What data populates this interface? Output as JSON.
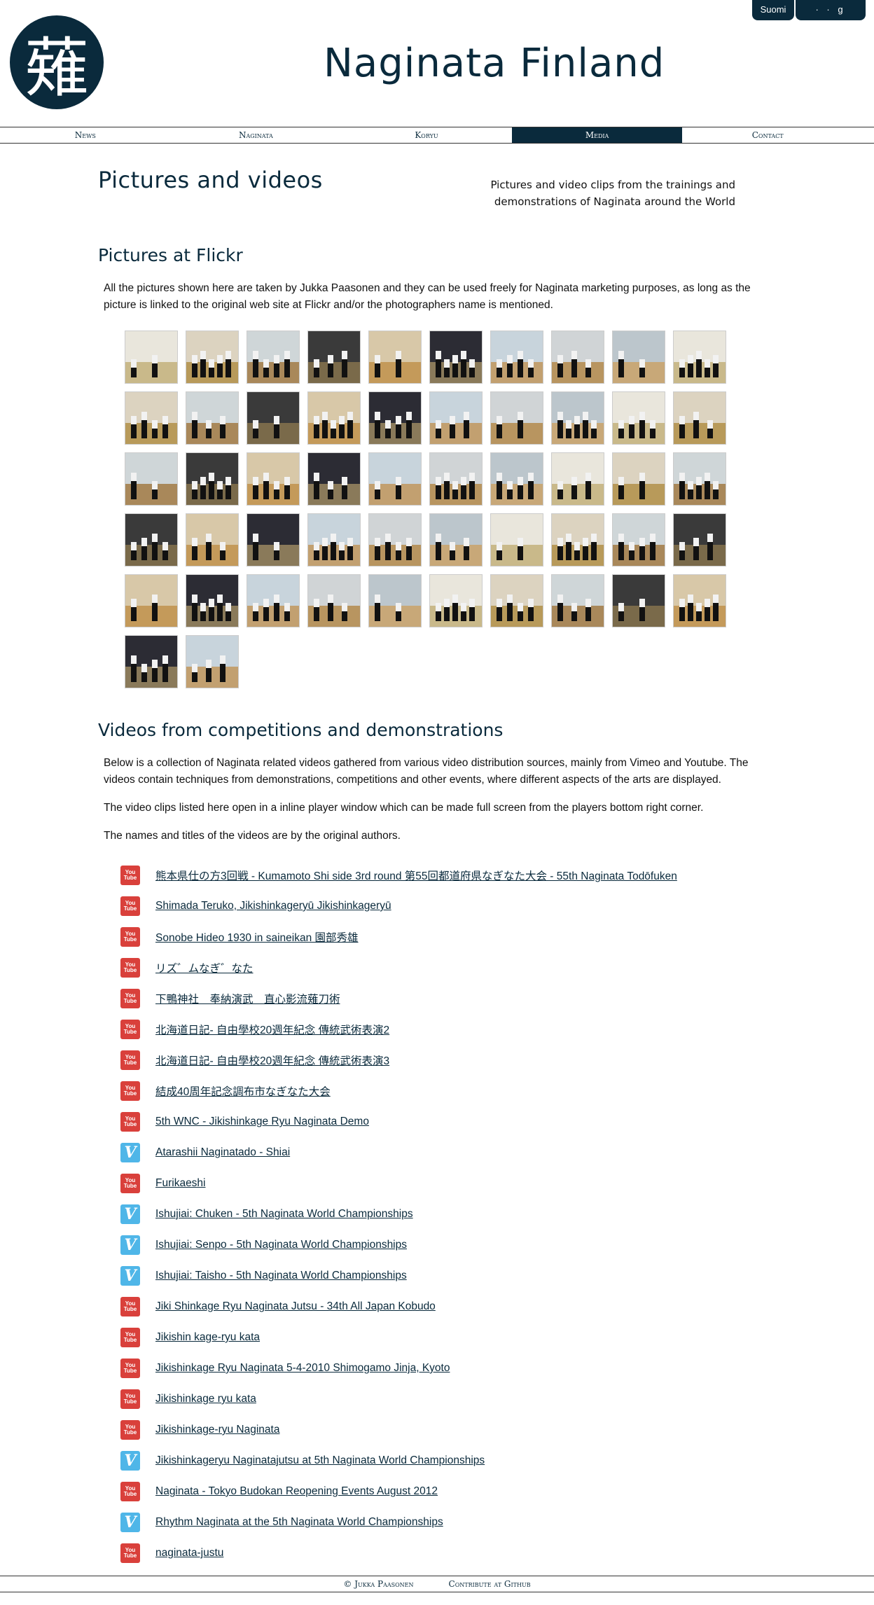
{
  "language": {
    "current": "Suomi",
    "other": "· · g"
  },
  "header": {
    "logo_glyph": "薙",
    "title": "Naginata Finland"
  },
  "nav": {
    "items": [
      {
        "label": "News",
        "active": false
      },
      {
        "label": "Naginata",
        "active": false
      },
      {
        "label": "Koryu",
        "active": false
      },
      {
        "label": "Media",
        "active": true
      },
      {
        "label": "Contact",
        "active": false
      }
    ]
  },
  "page": {
    "title": "Pictures and videos",
    "description": "Pictures and video clips from the trainings and demonstrations of Naginata around the World"
  },
  "flickr": {
    "heading": "Pictures at Flickr",
    "text": "All the pictures shown here are taken by Jukka Paasonen and they can be used freely for Naginata marketing purposes, as long as the picture is linked to the original web site at Flickr and/or the photographers name is mentioned.",
    "thumbnail_count": 52
  },
  "videos": {
    "heading": "Videos from competitions and demonstrations",
    "intro_1": "Below is a collection of Naginata related videos gathered from various video distribution sources, mainly from Vimeo and Youtube. The videos contain techniques from demonstrations, competitions and other events, where different aspects of the arts are displayed.",
    "intro_2": "The video clips listed here open in a inline player window which can be made full screen from the players bottom right corner.",
    "intro_3": "The names and titles of the videos are by the original authors.",
    "youtube_icon_text_1": "You",
    "youtube_icon_text_2": "Tube",
    "vimeo_icon_text": "V",
    "items": [
      {
        "source": "youtube",
        "title": "熊本県仕の方3回戦 - Kumamoto Shi side 3rd round 第55回都道府県なぎなた大会 - 55th Naginata Todōfuken"
      },
      {
        "source": "youtube",
        "title": "Shimada Teruko, Jikishinkageryū Jikishinkageryū"
      },
      {
        "source": "youtube",
        "title": "Sonobe Hideo 1930 in saineikan 園部秀雄"
      },
      {
        "source": "youtube",
        "title": "リズ゛ムなぎ゛なた"
      },
      {
        "source": "youtube",
        "title": "下鴨神社　奉納演武　直心影流薙刀術"
      },
      {
        "source": "youtube",
        "title": "北海道日記- 自由學校20週年紀念 傳統武術表演2"
      },
      {
        "source": "youtube",
        "title": "北海道日記- 自由學校20週年紀念 傳統武術表演3"
      },
      {
        "source": "youtube",
        "title": "結成40周年記念調布市なぎなた大会"
      },
      {
        "source": "youtube",
        "title": "5th WNC - Jikishinkage Ryu Naginata Demo"
      },
      {
        "source": "vimeo",
        "title": "Atarashii Naginatado - Shiai"
      },
      {
        "source": "youtube",
        "title": "Furikaeshi"
      },
      {
        "source": "vimeo",
        "title": "Ishujiai: Chuken - 5th Naginata World Championships"
      },
      {
        "source": "vimeo",
        "title": "Ishujiai: Senpo - 5th Naginata World Championships"
      },
      {
        "source": "vimeo",
        "title": "Ishujiai: Taisho - 5th Naginata World Championships"
      },
      {
        "source": "youtube",
        "title": "Jiki Shinkage Ryu Naginata Jutsu - 34th All Japan Kobudo"
      },
      {
        "source": "youtube",
        "title": "Jikishin kage-ryu kata"
      },
      {
        "source": "youtube",
        "title": "Jikishinkage Ryu Naginata 5-4-2010 Shimogamo Jinja, Kyoto"
      },
      {
        "source": "youtube",
        "title": "Jikishinkage ryu kata"
      },
      {
        "source": "youtube",
        "title": "Jikishinkage-ryu Naginata"
      },
      {
        "source": "vimeo",
        "title": "Jikishinkageryu Naginatajutsu at 5th Naginata World Championships"
      },
      {
        "source": "youtube",
        "title": "Naginata - Tokyo Budokan Reopening Events August 2012"
      },
      {
        "source": "vimeo",
        "title": "Rhythm Naginata at the 5th Naginata World Championships"
      },
      {
        "source": "youtube",
        "title": "naginata-justu"
      }
    ]
  },
  "footer": {
    "author": "© Jukka Paasonen",
    "github": "Contribute at Github"
  },
  "colors": {
    "brand": "#0a2a3c",
    "youtube": "#d9403b",
    "vimeo": "#4fb6e8"
  }
}
